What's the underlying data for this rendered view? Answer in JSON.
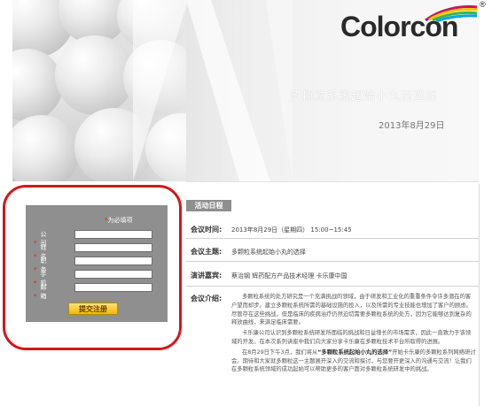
{
  "brand": {
    "logo_text": "Colorcon",
    "registered_mark": "®",
    "colors": {
      "red": "#d5161a",
      "yellow": "#f2c400",
      "cyan": "#00a7e0",
      "green": "#3bb54a",
      "magenta": "#c2185b"
    }
  },
  "header": {
    "title": "多颗粒系统起始小丸的选择",
    "date": "2013年8月29日"
  },
  "login": {
    "required_note": "为必填项",
    "required_star": "*",
    "fields": [
      {
        "label": "公　司",
        "value": ""
      },
      {
        "label": "姓　名",
        "value": ""
      },
      {
        "label": "职　务",
        "value": ""
      },
      {
        "label": "手　机",
        "value": ""
      },
      {
        "label": "邮　箱",
        "value": ""
      }
    ],
    "submit_label": "提交注册",
    "highlight_color": "#d5161a"
  },
  "schedule": {
    "heading": "活动日程",
    "rows": [
      {
        "label": "会议时间:",
        "value": "2013年8月29日（星期四） 15:00~15:45"
      },
      {
        "label": "会议主题:",
        "value": "多颗粒系统起始小丸的选择"
      },
      {
        "label": "演讲嘉宾:",
        "value": "蔡治钢  辉药配方产品技术经理  卡乐康中国"
      }
    ],
    "intro_label": "会议介绍:",
    "intro_paragraphs": [
      "多颗粒系统的处方研究是一个充满挑战的领域，由于研发和工业化的重重条件令许多潜在的客户望而却步。建立多颗粒系统所需的基础设施的投入，以及所需的专业技能也增加了客户的顾虑。尽管存在这些挑战，但是临床的疾病治疗仍然迫切需要多颗粒系统的处方，因为它能够达到复杂的释放曲线，来满足临床需要。",
      "卡乐康公司认识到多颗粒系统研发所面临的挑战和日益增长的市场需求，因此一直致力于该领域的开发。在本次系列讲座中我们向大家分享卡乐康在多颗粒技术平台所取得的进展。",
      "在8月29日下午3点，我们将从",
      "“多颗粒系统起始小丸的选择”",
      "开始卡乐康的多颗粒系列网络研讨会。期待和大家就多颗粒这一主题展开深入的交流和探讨，与您要开更深入的沟通与交流！让我们在多颗粒系统领域的成功起始可以帮助更多的客户面对多颗粒系统研发中的挑战。"
    ]
  }
}
